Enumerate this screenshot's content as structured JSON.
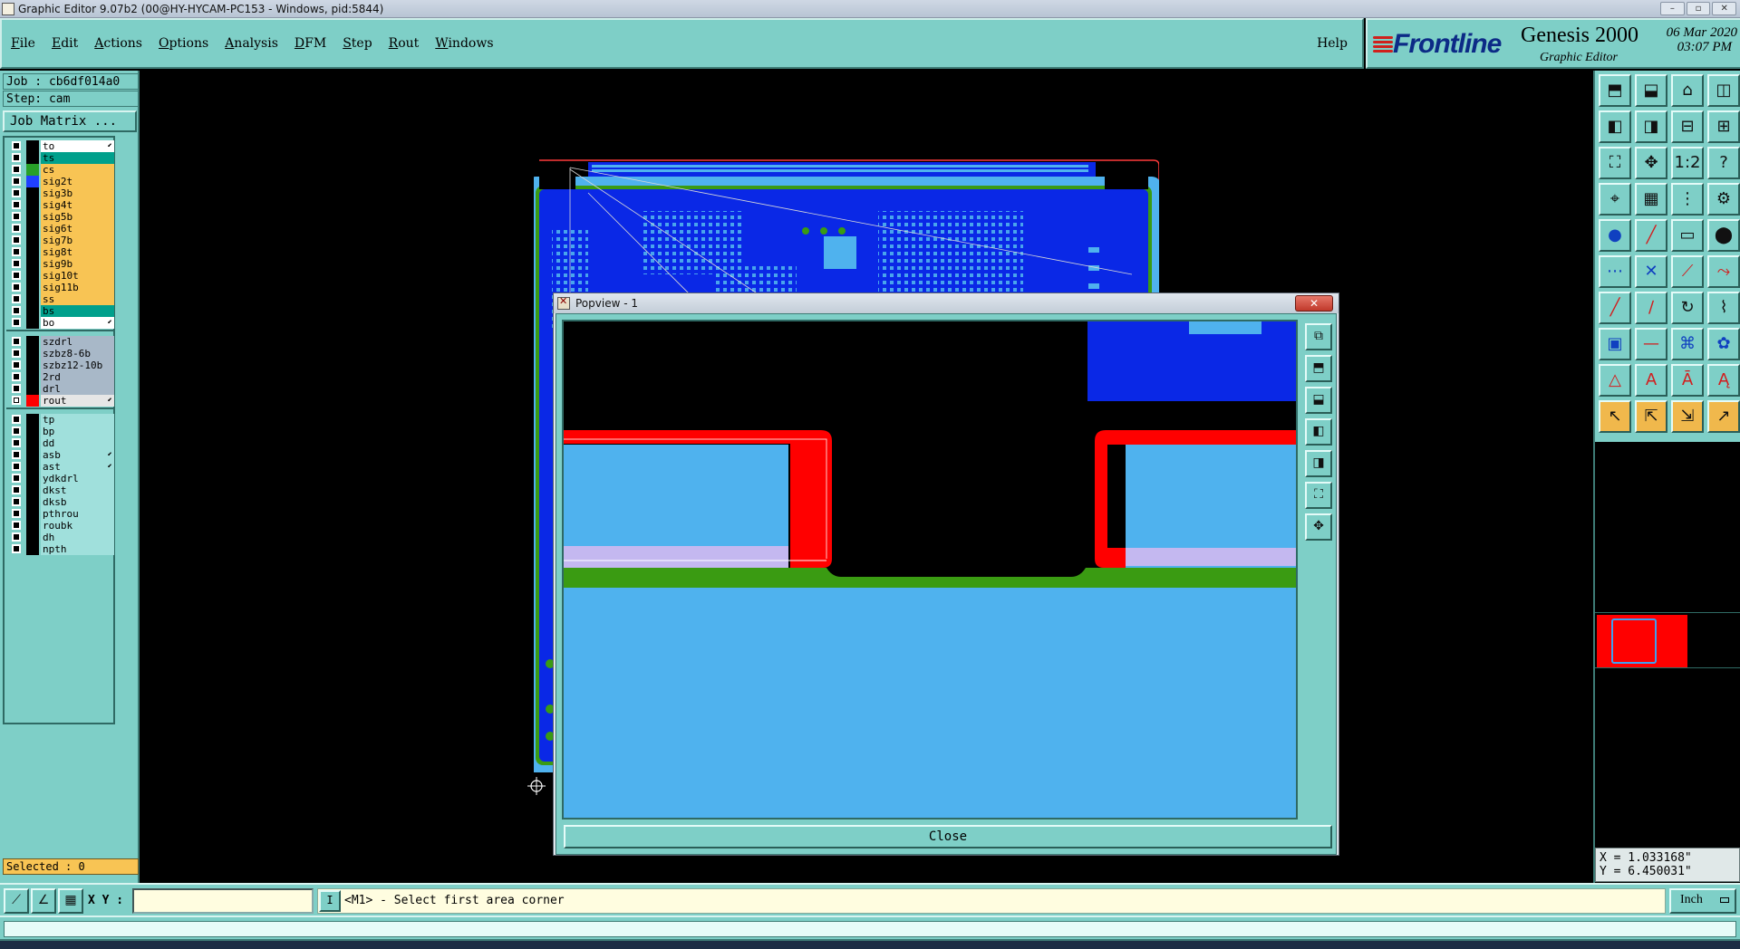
{
  "window": {
    "title": "Graphic Editor 9.07b2 (00@HY-HYCAM-PC153 - Windows, pid:5844)",
    "controls": [
      "–",
      "▫",
      "✕"
    ]
  },
  "menubar": {
    "items": [
      "File",
      "Edit",
      "Actions",
      "Options",
      "Analysis",
      "DFM",
      "Step",
      "Rout",
      "Windows"
    ],
    "help": "Help"
  },
  "logo": {
    "brand": "Frontline",
    "product": "Genesis 2000",
    "subtitle": "Graphic Editor",
    "date": "06 Mar 2020",
    "time": "03:07 PM"
  },
  "job": {
    "job_line": "Job : cb6df014a0",
    "step_line": "Step: cam",
    "matrix_button": "Job Matrix ..."
  },
  "layers": [
    {
      "name": "to",
      "color": "#ffffff",
      "swatch": "#000000",
      "checked": false,
      "mark": true
    },
    {
      "name": "ts",
      "color": "#00a08c",
      "swatch": "#000000",
      "checked": false,
      "mark": false
    },
    {
      "name": "cs",
      "color": "#f8c454",
      "swatch": "#28a028",
      "checked": false,
      "mark": false
    },
    {
      "name": "sig2t",
      "color": "#f8c454",
      "swatch": "#2040ff",
      "checked": false,
      "mark": false
    },
    {
      "name": "sig3b",
      "color": "#f8c454",
      "swatch": "#000000",
      "checked": false,
      "mark": false
    },
    {
      "name": "sig4t",
      "color": "#f8c454",
      "swatch": "#000000",
      "checked": false,
      "mark": false
    },
    {
      "name": "sig5b",
      "color": "#f8c454",
      "swatch": "#000000",
      "checked": false,
      "mark": false
    },
    {
      "name": "sig6t",
      "color": "#f8c454",
      "swatch": "#000000",
      "checked": false,
      "mark": false
    },
    {
      "name": "sig7b",
      "color": "#f8c454",
      "swatch": "#000000",
      "checked": false,
      "mark": false
    },
    {
      "name": "sig8t",
      "color": "#f8c454",
      "swatch": "#000000",
      "checked": false,
      "mark": false
    },
    {
      "name": "sig9b",
      "color": "#f8c454",
      "swatch": "#000000",
      "checked": false,
      "mark": false
    },
    {
      "name": "sig10t",
      "color": "#f8c454",
      "swatch": "#000000",
      "checked": false,
      "mark": false
    },
    {
      "name": "sig11b",
      "color": "#f8c454",
      "swatch": "#000000",
      "checked": false,
      "mark": false
    },
    {
      "name": "ss",
      "color": "#f8c454",
      "swatch": "#000000",
      "checked": false,
      "mark": false
    },
    {
      "name": "bs",
      "color": "#00a08c",
      "swatch": "#000000",
      "checked": false,
      "mark": false
    },
    {
      "name": "bo",
      "color": "#ffffff",
      "swatch": "#000000",
      "checked": false,
      "mark": true
    },
    {
      "name": "szdrl",
      "color": "#a8b8c8",
      "swatch": "#000000",
      "checked": false,
      "mark": false
    },
    {
      "name": "szbz8-6b",
      "color": "#a8b8c8",
      "swatch": "#000000",
      "checked": false,
      "mark": false
    },
    {
      "name": "szbz12-10b",
      "color": "#a8b8c8",
      "swatch": "#000000",
      "checked": false,
      "mark": false
    },
    {
      "name": "2rd",
      "color": "#a8b8c8",
      "swatch": "#000000",
      "checked": false,
      "mark": false
    },
    {
      "name": "drl",
      "color": "#a8b8c8",
      "swatch": "#000000",
      "checked": false,
      "mark": false
    },
    {
      "name": "rout",
      "color": "#e6e6e6",
      "swatch": "#ff0000",
      "checked": true,
      "mark": true
    },
    {
      "name": "tp",
      "color": "#a0e0dc",
      "swatch": "#000000",
      "checked": false,
      "mark": false
    },
    {
      "name": "bp",
      "color": "#a0e0dc",
      "swatch": "#000000",
      "checked": false,
      "mark": false
    },
    {
      "name": "dd",
      "color": "#a0e0dc",
      "swatch": "#000000",
      "checked": false,
      "mark": false
    },
    {
      "name": "asb",
      "color": "#a0e0dc",
      "swatch": "#000000",
      "checked": false,
      "mark": true
    },
    {
      "name": "ast",
      "color": "#a0e0dc",
      "swatch": "#000000",
      "checked": false,
      "mark": true
    },
    {
      "name": "ydkdrl",
      "color": "#a0e0dc",
      "swatch": "#000000",
      "checked": false,
      "mark": false
    },
    {
      "name": "dkst",
      "color": "#a0e0dc",
      "swatch": "#000000",
      "checked": false,
      "mark": false
    },
    {
      "name": "dksb",
      "color": "#a0e0dc",
      "swatch": "#000000",
      "checked": false,
      "mark": false
    },
    {
      "name": "pthrou",
      "color": "#a0e0dc",
      "swatch": "#000000",
      "checked": false,
      "mark": false
    },
    {
      "name": "roubk",
      "color": "#a0e0dc",
      "swatch": "#000000",
      "checked": false,
      "mark": false
    },
    {
      "name": "dh",
      "color": "#a0e0dc",
      "swatch": "#000000",
      "checked": false,
      "mark": false
    },
    {
      "name": "npth",
      "color": "#a0e0dc",
      "swatch": "#000000",
      "checked": false,
      "mark": false
    }
  ],
  "selected_text": "Selected : 0",
  "toolbar_icons": [
    "fit-job-icon",
    "fit-step-icon",
    "home-icon",
    "profile-icon",
    "pan-left-icon",
    "pan-right-icon",
    "zoom-out-icon",
    "zoom-in-icon",
    "fit-screen-icon",
    "center-icon",
    "ratio-icon",
    "query-icon",
    "measure-icon",
    "grid-icon",
    "snap-icon",
    "snap-settings-icon",
    "pad-icon",
    "line-add-icon",
    "ruler-icon",
    "circle-pad-icon",
    "node-icon",
    "cross-icon",
    "connect-icon",
    "connect-arc-icon",
    "line-icon",
    "line-red-icon",
    "arc-icon",
    "polyline-icon",
    "box-icon",
    "hline-icon",
    "symbol-icon",
    "pattern-icon",
    "triangle-icon",
    "text-icon",
    "text-box-icon",
    "text-mirror-icon",
    "select-icon",
    "select-move-icon",
    "select-copy-icon",
    "select-step-icon"
  ],
  "coords": {
    "x": "X = 1.033168\"",
    "y": "Y = 6.450031\""
  },
  "popview": {
    "title": "Popview - 1",
    "close_label": "Close",
    "close_x": "✕",
    "tool_icons": [
      "zoom-home-icon",
      "zoom-fit-icon",
      "zoom-window-icon",
      "zoom-in-icon",
      "zoom-out-icon",
      "pan-icon",
      "center-icon"
    ]
  },
  "cmdbar": {
    "xy_label": "X Y :",
    "xy_value": "",
    "status": "<M1> - Select first area corner",
    "info_glyph": "I",
    "units": "Inch"
  },
  "colors": {
    "panel": "#7ecfc7",
    "board_blue": "#0a28e6",
    "copper_light": "#4fb2ee",
    "rout_red": "#ff0000",
    "solder_green": "#3a9b12",
    "lavender": "#c4b8f0"
  }
}
